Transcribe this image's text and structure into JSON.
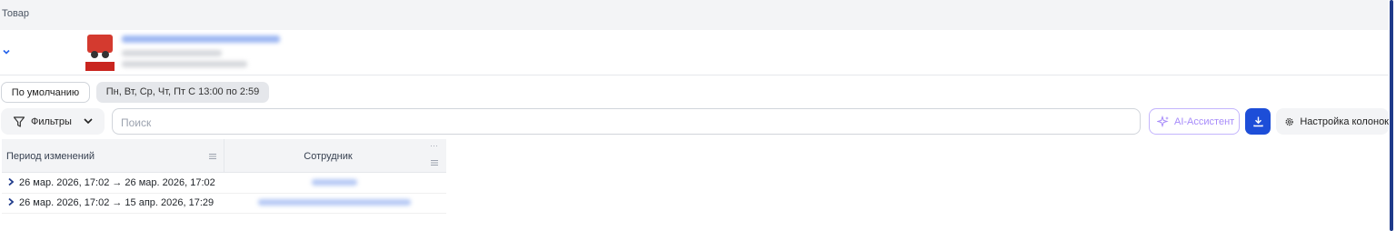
{
  "header": {
    "column_label": "Товар"
  },
  "product": {
    "expand_icon": "chevron-down-icon",
    "thumbnail_icon": "fire-truck-image",
    "name_blurred": true
  },
  "chips": {
    "default_label": "По умолчанию",
    "schedule_label": "Пн, Вт, Ср, Чт, Пт С 13:00 по 2:59"
  },
  "toolbar": {
    "filters_label": "Фильтры",
    "search_placeholder": "Поиск",
    "ai_label": "AI-Ассистент",
    "download_icon": "download-icon",
    "columns_label": "Настройка колонок"
  },
  "table": {
    "columns": [
      "Период изменений",
      "Сотрудник"
    ],
    "rows": [
      {
        "period": "26 мар. 2026, 17:02 → 26 мар. 2026, 17:02",
        "employee_blurred": true
      },
      {
        "period": "26 мар. 2026, 17:02 → 15 апр. 2026, 17:29",
        "employee_blurred": true
      }
    ]
  },
  "colors": {
    "accent": "#1d4ed8",
    "ai_accent": "#a78bfa",
    "header_bg": "#f3f4f6"
  }
}
